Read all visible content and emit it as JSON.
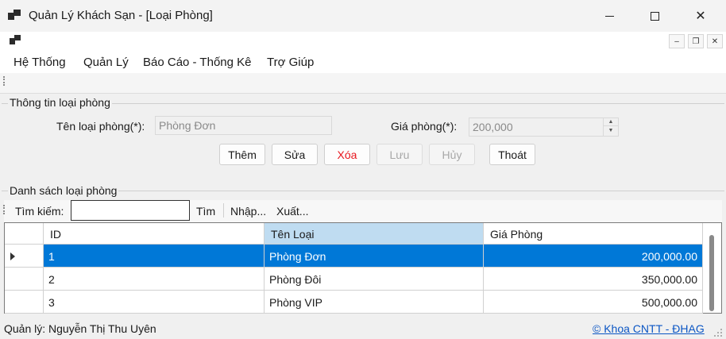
{
  "window": {
    "title": "Quản Lý Khách Sạn - [Loại Phòng]",
    "close_glyph": "✕"
  },
  "mdi": {
    "min_glyph": "–",
    "restore_glyph": "❐",
    "close_glyph": "✕"
  },
  "menu": {
    "items": [
      "Hệ Thống",
      "Quản Lý",
      "Báo Cáo - Thống Kê",
      "Trợ Giúp"
    ]
  },
  "info_group": {
    "title": "Thông tin loại phòng",
    "name_label": "Tên loại phòng(*):",
    "name_value": "Phòng Đơn",
    "price_label": "Giá phòng(*):",
    "price_value": "200,000"
  },
  "buttons": {
    "add": "Thêm",
    "edit": "Sửa",
    "delete": "Xóa",
    "save": "Lưu",
    "cancel": "Hủy",
    "exit": "Thoát"
  },
  "list_group": {
    "title": "Danh sách loại phòng",
    "search_label": "Tìm kiếm:",
    "search_value": "",
    "search_button": "Tìm",
    "import_button": "Nhập...",
    "export_button": "Xuất..."
  },
  "table": {
    "columns": [
      "ID",
      "Tên Loại",
      "Giá Phòng"
    ],
    "rows": [
      {
        "id": "1",
        "name": "Phòng Đơn",
        "price": "200,000.00"
      },
      {
        "id": "2",
        "name": "Phòng Đôi",
        "price": "350,000.00"
      },
      {
        "id": "3",
        "name": "Phòng VIP",
        "price": "500,000.00"
      }
    ],
    "selected_row": 0
  },
  "status": {
    "user": "Quản lý: Nguyễn Thị Thu Uyên",
    "link": "© Khoa CNTT - ĐHAG"
  },
  "colors": {
    "selection": "#0078d7",
    "header_selected": "#bfdcf1",
    "delete_text": "#e8171f",
    "link": "#0b56c4"
  }
}
